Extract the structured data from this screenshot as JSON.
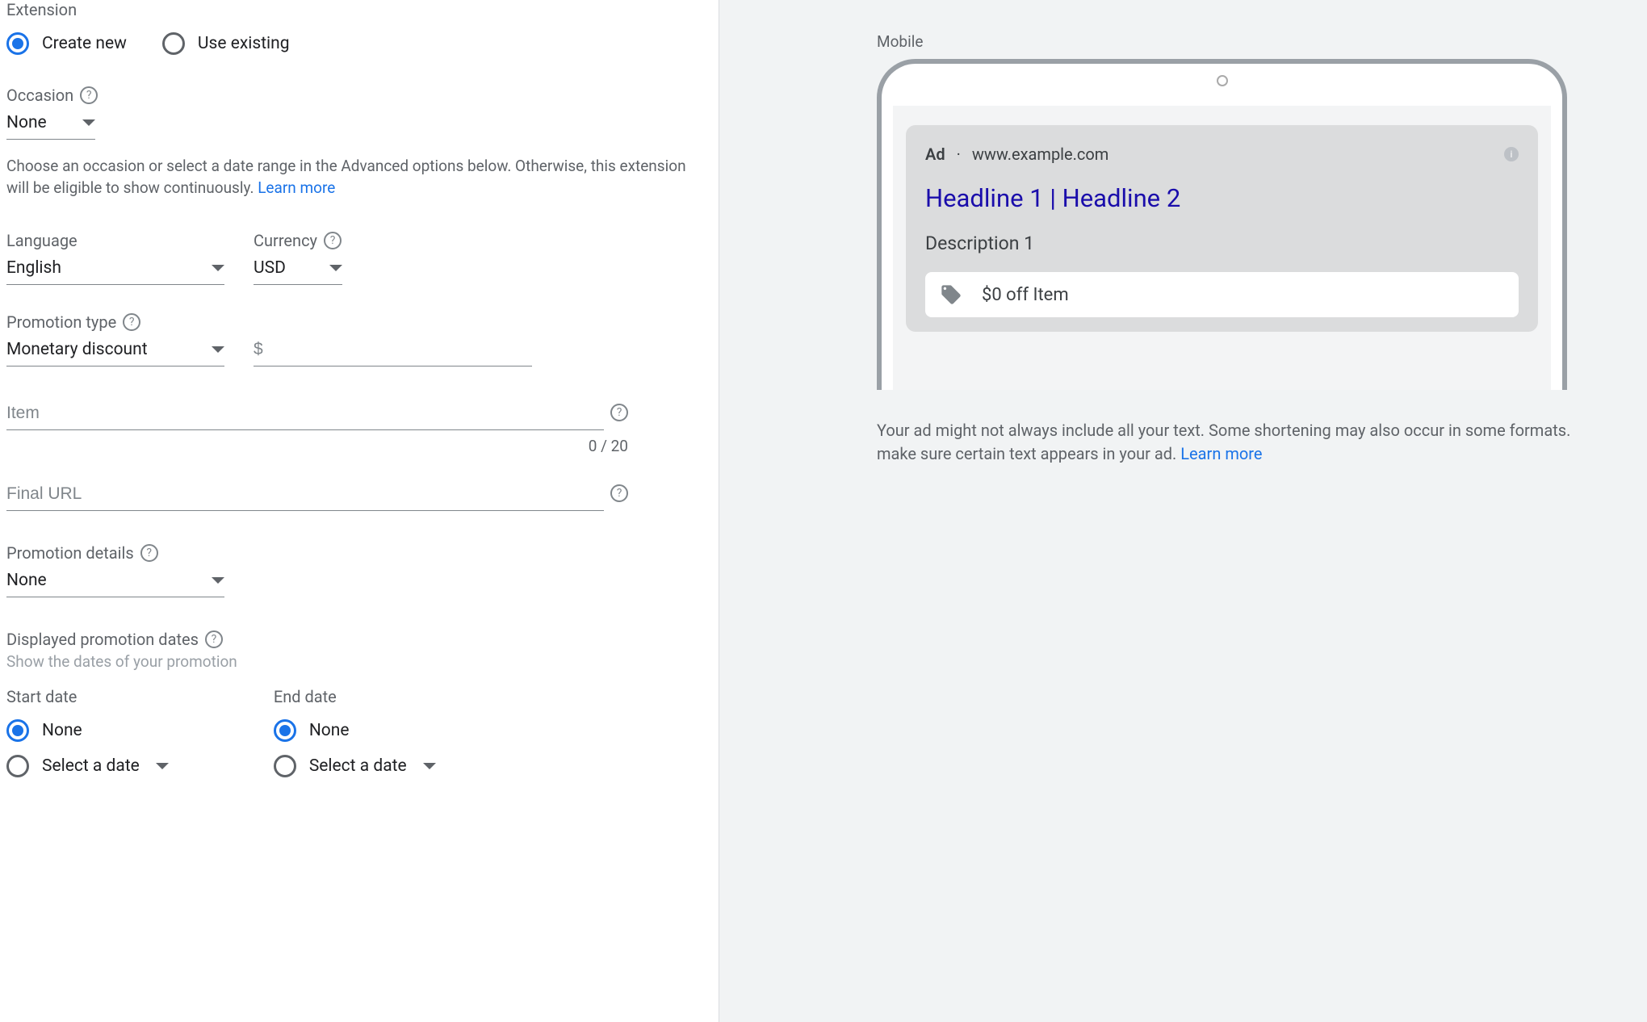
{
  "extension": {
    "section_label": "Extension",
    "create_new": "Create new",
    "use_existing": "Use existing"
  },
  "occasion": {
    "label": "Occasion",
    "value": "None",
    "helper": "Choose an occasion or select a date range in the Advanced options below. Otherwise, this extension will be eligible to show continuously. ",
    "learn_more": "Learn more"
  },
  "language": {
    "label": "Language",
    "value": "English"
  },
  "currency": {
    "label": "Currency",
    "value": "USD"
  },
  "promotion_type": {
    "label": "Promotion type",
    "value": "Monetary discount",
    "amount_placeholder": "$"
  },
  "item": {
    "placeholder": "Item",
    "counter": "0 / 20"
  },
  "final_url": {
    "placeholder": "Final URL"
  },
  "promotion_details": {
    "label": "Promotion details",
    "value": "None"
  },
  "displayed_dates": {
    "label": "Displayed promotion dates",
    "sub": "Show the dates of your promotion"
  },
  "start_date": {
    "label": "Start date",
    "none": "None",
    "select": "Select a date"
  },
  "end_date": {
    "label": "End date",
    "none": "None",
    "select": "Select a date"
  },
  "preview": {
    "label": "Mobile",
    "ad_badge": "Ad",
    "url": "www.example.com",
    "headline": "Headline 1 | Headline 2",
    "description": "Description 1",
    "promo_text": "$0 off Item",
    "note": "Your ad might not always include all your text. Some shortening may also occur in some formats. make sure certain text appears in your ad. ",
    "note_link": "Learn more"
  }
}
